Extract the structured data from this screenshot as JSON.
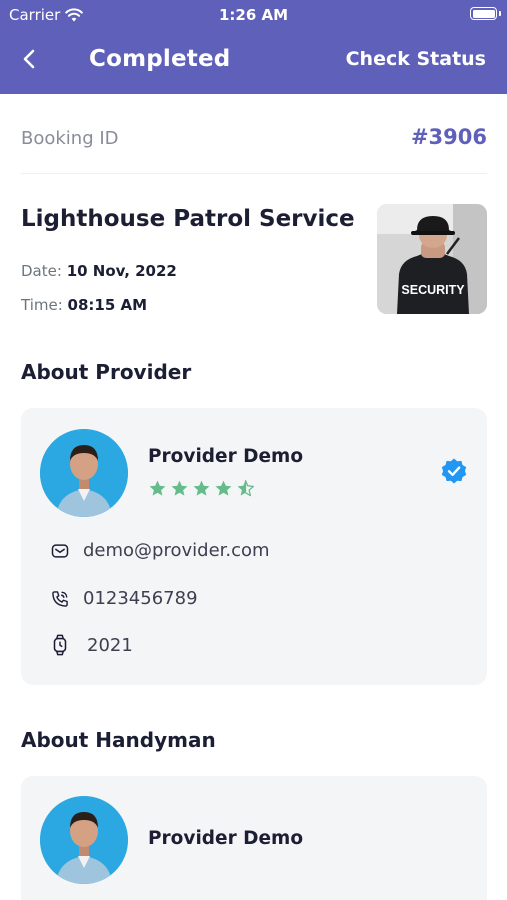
{
  "status_bar": {
    "carrier": "Carrier",
    "time": "1:26 AM"
  },
  "header": {
    "title": "Completed",
    "action_label": "Check Status"
  },
  "booking": {
    "label": "Booking ID",
    "id": "#3906"
  },
  "service": {
    "name": "Lighthouse Patrol Service",
    "date_label": "Date:",
    "date_value": "10 Nov, 2022",
    "time_label": "Time:",
    "time_value": "08:15 AM",
    "image_text": "SECURITY"
  },
  "provider_section": {
    "title": "About Provider",
    "name": "Provider Demo",
    "rating": 4.5,
    "email": "demo@provider.com",
    "phone": "0123456789",
    "year": "2021"
  },
  "handyman_section": {
    "title": "About Handyman",
    "name": "Provider Demo"
  },
  "colors": {
    "primary": "#5f60b9",
    "star": "#66bb8a",
    "verified": "#2196f3",
    "card_bg": "#f4f5f7"
  }
}
